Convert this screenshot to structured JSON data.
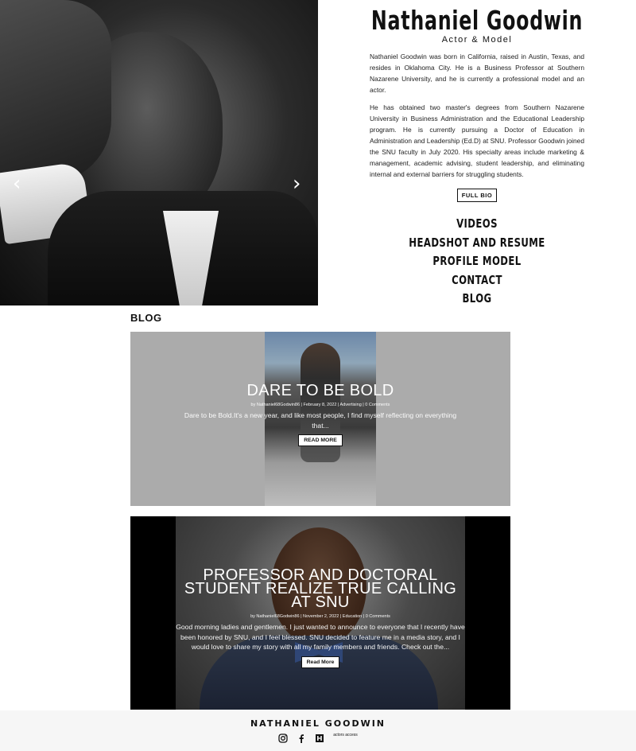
{
  "hero": {
    "prev_arrow": "‹",
    "next_arrow": "›"
  },
  "bio": {
    "name": "Nathaniel Goodwin",
    "subtitle": "Actor & Model",
    "paragraph1": "Nathaniel Goodwin was born in California, raised in Austin, Texas, and resides in Oklahoma City. He is a Business Professor at Southern Nazarene University, and he is currently a professional model and an actor.",
    "paragraph2": "He has obtained two master's degrees from Southern Nazarene University in Business Administration and the Educational Leadership program. He is currently pursuing a Doctor of Education in Administration and Leadership (Ed.D) at SNU. Professor Goodwin joined the SNU faculty in July 2020. His specialty areas include marketing & management, academic advising, student leadership, and eliminating internal and external barriers for struggling students.",
    "full_bio_label": "FULL BIO"
  },
  "nav": {
    "items": [
      "VIDEOS",
      "HEADSHOT AND RESUME",
      "PROFILE MODEL",
      "CONTACT",
      "BLOG"
    ]
  },
  "blog": {
    "heading": "BLOG",
    "posts": [
      {
        "title": "DARE TO BE BOLD",
        "meta": "by Nathaniel68Godwin86 | February 8, 2022 | Advertising | 0 Comments",
        "excerpt": "Dare to be Bold.It's a new year, and like most people, I find myself reflecting on everything that...",
        "read_more": "READ MORE"
      },
      {
        "title": "PROFESSOR AND DOCTORAL STUDENT REALIZE TRUE CALLING AT SNU",
        "meta": "by Nathaniel68Godwin86 | November 2, 2022 | Education | 0 Comments",
        "excerpt": "Good morning ladies and gentlemen. I just wanted to announce to everyone that I recently have been honored by SNU, and I feel blessed. SNU decided to feature me in a media story, and I would love to share my story with all my family members and friends. Check out the...",
        "read_more": "Read More"
      }
    ]
  },
  "footer": {
    "name": "NATHANIEL GOODWIN",
    "social": [
      "instagram-icon",
      "facebook-icon",
      "imdb-icon",
      "actors-access-icon"
    ],
    "actors_access_text": "actors access"
  }
}
